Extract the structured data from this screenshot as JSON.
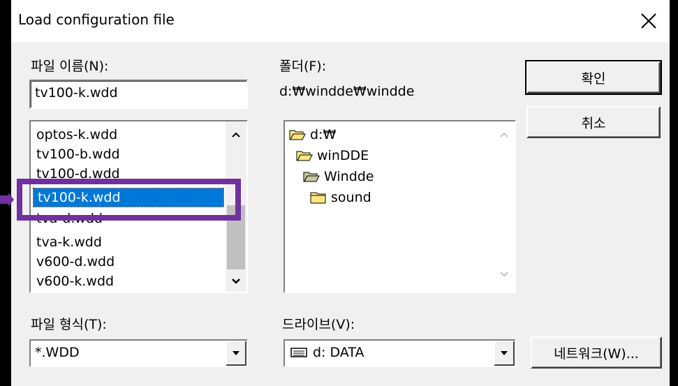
{
  "dialog": {
    "title": "Load configuration file",
    "close_glyph": "×"
  },
  "file_name": {
    "label": "파일 이름(N):",
    "value": "tv100-k.wdd",
    "files": [
      "optos-k.wdd",
      "tv100-b.wdd",
      "tv100-d.wdd",
      "tv100-k.wdd",
      "tva-d.wdd",
      "tva-k.wdd",
      "v600-d.wdd",
      "v600-k.wdd"
    ],
    "selected": "tv100-k.wdd"
  },
  "folder": {
    "label": "폴더(F):",
    "path": "d:₩windde₩windde",
    "tree": [
      "d:₩",
      "winDDE",
      "Windde",
      "sound"
    ]
  },
  "file_type": {
    "label": "파일 형식(T):",
    "value": "*.WDD"
  },
  "drive": {
    "label": "드라이브(V):",
    "value": "d: DATA"
  },
  "buttons": {
    "ok": "확인",
    "cancel": "취소",
    "network": "네트워크(W)..."
  },
  "colors": {
    "selection": "#0078d7",
    "annotation": "#7030a0",
    "folder_yellow": "#ffe680"
  }
}
